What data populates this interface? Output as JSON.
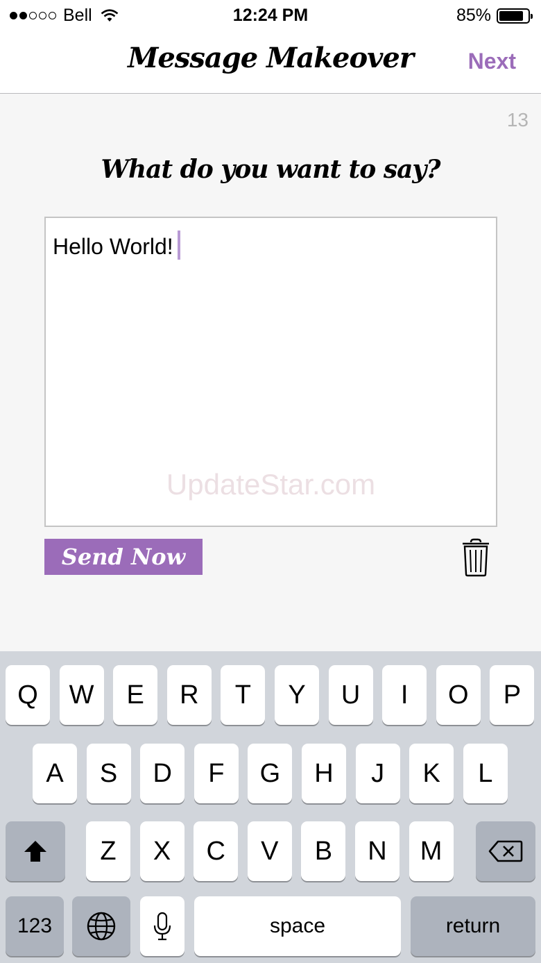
{
  "status_bar": {
    "carrier": "Bell",
    "time": "12:24 PM",
    "battery": "85%",
    "battery_fraction": 0.85
  },
  "nav": {
    "title": "Message Makeover",
    "next_label": "Next"
  },
  "editor": {
    "char_count": "13",
    "prompt": "What do you want to say?",
    "message": "Hello World!",
    "watermark": "UpdateStar.com",
    "send_label": "Send Now"
  },
  "keyboard": {
    "row1": [
      "Q",
      "W",
      "E",
      "R",
      "T",
      "Y",
      "U",
      "I",
      "O",
      "P"
    ],
    "row2": [
      "A",
      "S",
      "D",
      "F",
      "G",
      "H",
      "J",
      "K",
      "L"
    ],
    "row3": [
      "Z",
      "X",
      "C",
      "V",
      "B",
      "N",
      "M"
    ],
    "numbers_label": "123",
    "space_label": "space",
    "return_label": "return"
  },
  "colors": {
    "accent": "#9b6cb9",
    "keyboard_bg": "#d1d5db",
    "content_bg": "#f6f6f6"
  }
}
